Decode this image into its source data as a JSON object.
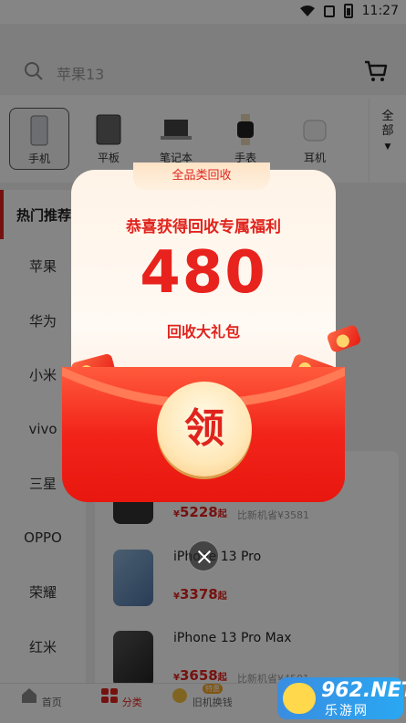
{
  "status_bar": {
    "time": "11:27"
  },
  "search": {
    "placeholder": "苹果13"
  },
  "categories": [
    {
      "label": "手机",
      "icon": "phone-icon",
      "active": true
    },
    {
      "label": "平板",
      "icon": "tablet-icon"
    },
    {
      "label": "笔记本",
      "icon": "laptop-icon"
    },
    {
      "label": "手表",
      "icon": "watch-icon"
    },
    {
      "label": "耳机",
      "icon": "earbuds-icon"
    }
  ],
  "more_label": "全部",
  "brand_list": {
    "header": "热门推荐",
    "items": [
      "苹果",
      "华为",
      "小米",
      "vivo",
      "三星",
      "OPPO",
      "荣耀",
      "红米"
    ]
  },
  "products": [
    {
      "name": "",
      "price": "5228",
      "unit": "起",
      "currency": "¥",
      "save": "比新机省¥3581"
    },
    {
      "name": "iPhone 13 Pro",
      "price": "3378",
      "unit": "起",
      "currency": "¥",
      "save": ""
    },
    {
      "name": "iPhone 13 Pro Max",
      "price": "3658",
      "unit": "起",
      "currency": "¥",
      "save": "比新机省¥4501"
    }
  ],
  "tabs": [
    {
      "label": "首页",
      "icon": "home-icon"
    },
    {
      "label": "分类",
      "icon": "category-icon",
      "active": true
    },
    {
      "label": "旧机换钱",
      "icon": "trade-in-icon",
      "badge": "特惠"
    }
  ],
  "popup": {
    "tag": "全品类回收",
    "headline": "恭喜获得回收专属福利",
    "amount": "480",
    "subtitle": "回收大礼包",
    "claim_label": "领"
  },
  "watermark": {
    "big": "962.NET",
    "small": "乐游网"
  },
  "colors": {
    "accent": "#e0231d",
    "envelope": "#f2241a",
    "cream": "#fff3e7"
  }
}
